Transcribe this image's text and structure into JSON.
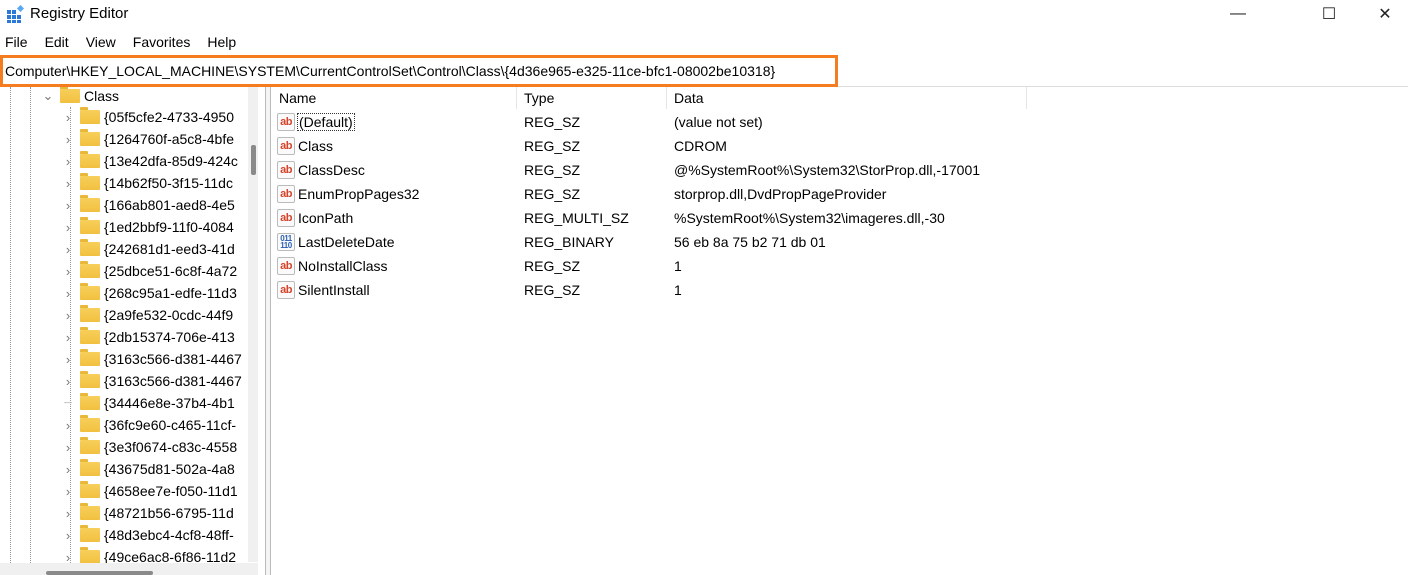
{
  "window": {
    "title": "Registry Editor",
    "minimize": "—",
    "maximize": "☐",
    "close": "✕"
  },
  "menu": [
    "File",
    "Edit",
    "View",
    "Favorites",
    "Help"
  ],
  "address": "Computer\\HKEY_LOCAL_MACHINE\\SYSTEM\\CurrentControlSet\\Control\\Class\\{4d36e965-e325-11ce-bfc1-08002be10318}",
  "accent": "#f57c1f",
  "tree": {
    "parent": "Class",
    "children": [
      "{05f5cfe2-4733-4950",
      "{1264760f-a5c8-4bfe",
      "{13e42dfa-85d9-424c",
      "{14b62f50-3f15-11dc",
      "{166ab801-aed8-4e5",
      "{1ed2bbf9-11f0-4084",
      "{242681d1-eed3-41d",
      "{25dbce51-6c8f-4a72",
      "{268c95a1-edfe-11d3",
      "{2a9fe532-0cdc-44f9",
      "{2db15374-706e-413",
      "{3163c566-d381-4467",
      "{3163c566-d381-4467",
      "{34446e8e-37b4-4b1",
      "{36fc9e60-c465-11cf-",
      "{3e3f0674-c83c-4558",
      "{43675d81-502a-4a8",
      "{4658ee7e-f050-11d1",
      "{48721b56-6795-11d",
      "{48d3ebc4-4cf8-48ff-",
      "{49ce6ac8-6f86-11d2"
    ]
  },
  "columns": {
    "name": "Name",
    "type": "Type",
    "data": "Data"
  },
  "values": [
    {
      "name": "(Default)",
      "type": "REG_SZ",
      "data": "(value not set)",
      "icon": "string"
    },
    {
      "name": "Class",
      "type": "REG_SZ",
      "data": "CDROM",
      "icon": "string"
    },
    {
      "name": "ClassDesc",
      "type": "REG_SZ",
      "data": "@%SystemRoot%\\System32\\StorProp.dll,-17001",
      "icon": "string"
    },
    {
      "name": "EnumPropPages32",
      "type": "REG_SZ",
      "data": "storprop.dll,DvdPropPageProvider",
      "icon": "string"
    },
    {
      "name": "IconPath",
      "type": "REG_MULTI_SZ",
      "data": "%SystemRoot%\\System32\\imageres.dll,-30",
      "icon": "string"
    },
    {
      "name": "LastDeleteDate",
      "type": "REG_BINARY",
      "data": "56 eb 8a 75 b2 71 db 01",
      "icon": "binary"
    },
    {
      "name": "NoInstallClass",
      "type": "REG_SZ",
      "data": "1",
      "icon": "string"
    },
    {
      "name": "SilentInstall",
      "type": "REG_SZ",
      "data": "1",
      "icon": "string"
    }
  ]
}
